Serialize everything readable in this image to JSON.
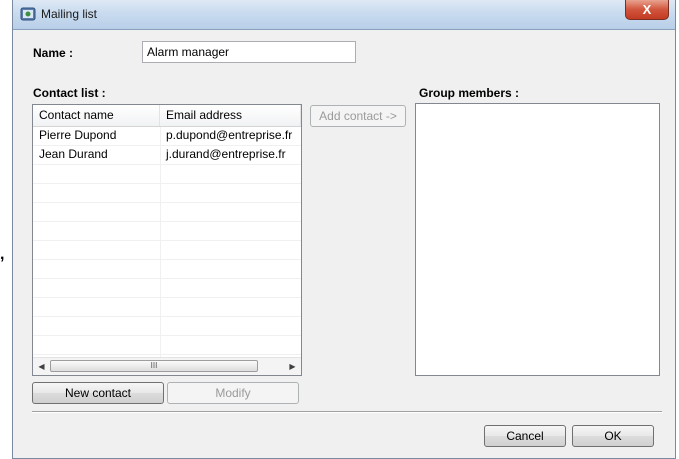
{
  "window": {
    "title": "Mailing list",
    "close_glyph": "X"
  },
  "form": {
    "name_label": "Name :",
    "name_value": "Alarm manager",
    "contact_list_label": "Contact list :",
    "group_members_label": "Group members :"
  },
  "contact_list": {
    "columns": [
      "Contact name",
      "Email address"
    ],
    "rows": [
      [
        "Pierre Dupond",
        "p.dupond@entreprise.fr"
      ],
      [
        "Jean Durand",
        "j.durand@entreprise.fr"
      ],
      [
        "",
        ""
      ],
      [
        "",
        ""
      ],
      [
        "",
        ""
      ],
      [
        "",
        ""
      ],
      [
        "",
        ""
      ],
      [
        "",
        ""
      ],
      [
        "",
        ""
      ],
      [
        "",
        ""
      ],
      [
        "",
        ""
      ],
      [
        "",
        ""
      ]
    ],
    "scroll_left_glyph": "◀",
    "scroll_right_glyph": "▶",
    "scroll_thumb_grip": "III"
  },
  "buttons": {
    "add_contact": "Add contact ->",
    "new_contact": "New contact",
    "modify": "Modify",
    "cancel": "Cancel",
    "ok": "OK"
  },
  "side_mark": ","
}
